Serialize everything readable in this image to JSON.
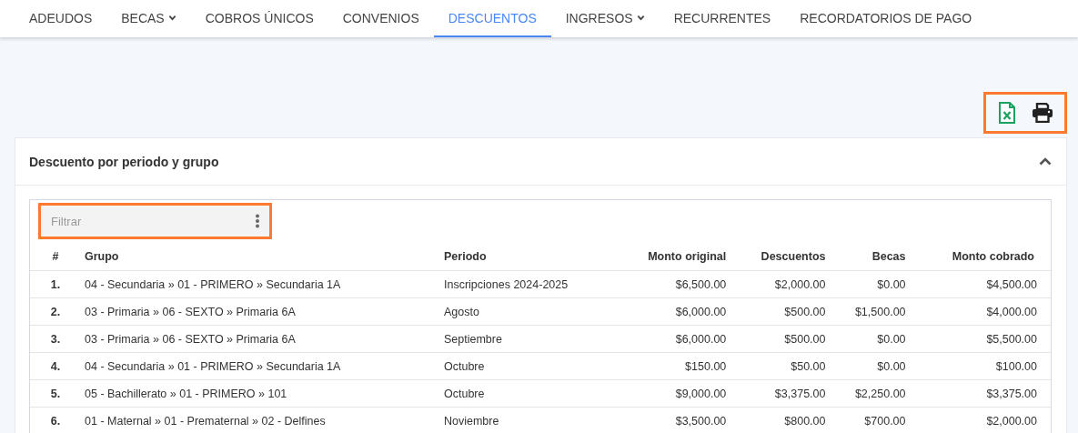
{
  "nav_tabs": [
    {
      "label": "ADEUDOS",
      "selected": false,
      "dropdown": false
    },
    {
      "label": "BECAS",
      "selected": false,
      "dropdown": true
    },
    {
      "label": "COBROS ÚNICOS",
      "selected": false,
      "dropdown": false
    },
    {
      "label": "CONVENIOS",
      "selected": false,
      "dropdown": false
    },
    {
      "label": "DESCUENTOS",
      "selected": true,
      "dropdown": false
    },
    {
      "label": "INGRESOS",
      "selected": false,
      "dropdown": true
    },
    {
      "label": "RECURRENTES",
      "selected": false,
      "dropdown": false
    },
    {
      "label": "RECORDATORIOS DE PAGO",
      "selected": false,
      "dropdown": false
    }
  ],
  "export_toolbar": {
    "highlighted": true
  },
  "card": {
    "title": "Descuento por periodo y grupo",
    "expanded": true
  },
  "filter": {
    "placeholder": "Filtrar",
    "highlighted": true
  },
  "table": {
    "columns": [
      "#",
      "Grupo",
      "Periodo",
      "Monto original",
      "Descuentos",
      "Becas",
      "Monto cobrado"
    ],
    "rows": [
      [
        "1.",
        "04 - Secundaria » 01 - PRIMERO » Secundaria 1A",
        "Inscripciones 2024-2025",
        "$6,500.00",
        "$2,000.00",
        "$0.00",
        "$4,500.00"
      ],
      [
        "2.",
        "03 - Primaria » 06 - SEXTO » Primaria 6A",
        "Agosto",
        "$6,000.00",
        "$500.00",
        "$1,500.00",
        "$4,000.00"
      ],
      [
        "3.",
        "03 - Primaria » 06 - SEXTO » Primaria 6A",
        "Septiembre",
        "$6,000.00",
        "$500.00",
        "$0.00",
        "$5,500.00"
      ],
      [
        "4.",
        "04 - Secundaria » 01 - PRIMERO » Secundaria 1A",
        "Octubre",
        "$150.00",
        "$50.00",
        "$0.00",
        "$100.00"
      ],
      [
        "5.",
        "05 - Bachillerato » 01 - PRIMERO » 101",
        "Octubre",
        "$9,000.00",
        "$3,375.00",
        "$2,250.00",
        "$3,375.00"
      ],
      [
        "6.",
        "01 - Maternal » 01 - Prematernal » 02 - Delfines",
        "Noviembre",
        "$3,500.00",
        "$800.00",
        "$700.00",
        "$2,000.00"
      ]
    ]
  }
}
